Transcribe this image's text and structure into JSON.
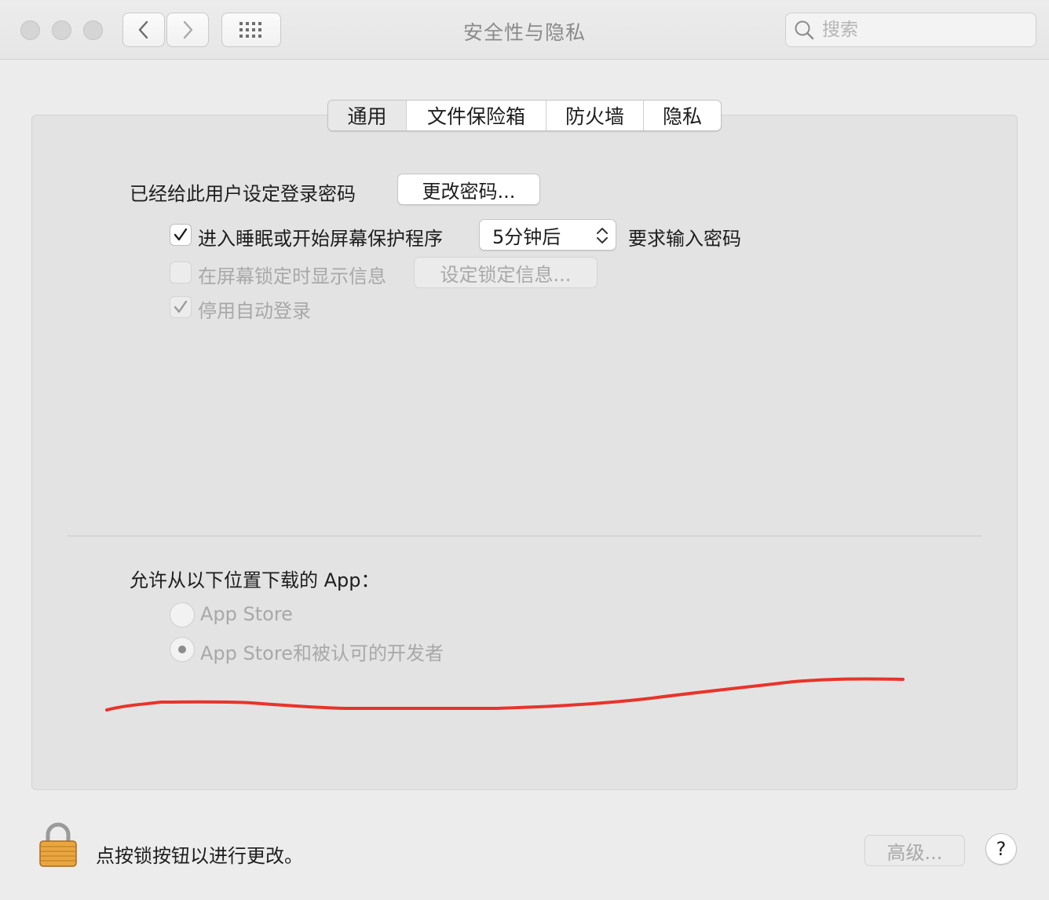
{
  "window": {
    "title": "安全性与隐私"
  },
  "search": {
    "placeholder": "搜索"
  },
  "tabs": [
    {
      "label": "通用",
      "active": true
    },
    {
      "label": "文件保险箱",
      "active": false
    },
    {
      "label": "防火墙",
      "active": false
    },
    {
      "label": "隐私",
      "active": false
    }
  ],
  "general": {
    "password_label": "已经给此用户设定登录密码",
    "change_password_button": "更改密码...",
    "require_password": {
      "checked": true,
      "label": "进入睡眠或开始屏幕保护程序",
      "delay_value": "5分钟后",
      "suffix": "要求输入密码"
    },
    "show_message": {
      "checked": false,
      "label": "在屏幕锁定时显示信息",
      "button": "设定锁定信息..."
    },
    "disable_auto_login": {
      "checked": true,
      "label": "停用自动登录"
    }
  },
  "downloads": {
    "heading": "允许从以下位置下载的 App：",
    "options": [
      {
        "label": "App Store",
        "selected": false
      },
      {
        "label": "App Store和被认可的开发者",
        "selected": true
      }
    ]
  },
  "footer": {
    "lock_message": "点按锁按钮以进行更改。",
    "advanced_button": "高级...",
    "help_button": "?"
  },
  "colors": {
    "annotation_stroke": "#e8342a",
    "lock_body": "#e9a640"
  }
}
